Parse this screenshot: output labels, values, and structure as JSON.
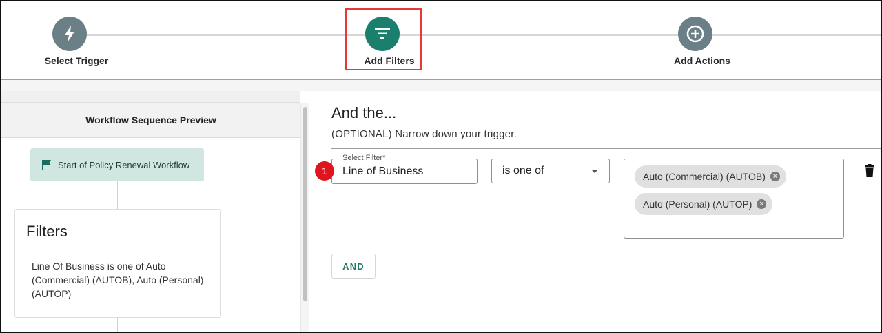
{
  "stepper": {
    "steps": [
      {
        "label": "Select Trigger",
        "icon": "lightning-icon",
        "color": "#6b8086"
      },
      {
        "label": "Add Filters",
        "icon": "filter-icon",
        "color": "#1a7f6c",
        "active": true
      },
      {
        "label": "Add Actions",
        "icon": "add-circle-icon",
        "color": "#6b8086"
      }
    ]
  },
  "preview": {
    "header": "Workflow Sequence Preview",
    "start_node": {
      "label": "Start of Policy Renewal Workflow",
      "icon": "flag-icon"
    },
    "filters_card": {
      "title": "Filters",
      "description": "Line Of Business is one of Auto (Commercial) (AUTOB), Auto (Personal) (AUTOP)"
    }
  },
  "main": {
    "title": "And the...",
    "subtitle": "(OPTIONAL) Narrow down your trigger.",
    "badge_number": "1",
    "filter_row": {
      "filter_label": "Select Filter*",
      "filter_value": "Line of Business",
      "operator": "is one of",
      "chips": [
        "Auto (Commercial) (AUTOB)",
        "Auto (Personal) (AUTOP)"
      ],
      "delete_icon": "trash-icon"
    },
    "and_button": "AND"
  },
  "colors": {
    "accent": "#1a7f6c",
    "step_inactive": "#6b8086",
    "highlight": "#e53935",
    "badge": "#e0141e",
    "start_node_bg": "#cfe6e1"
  }
}
